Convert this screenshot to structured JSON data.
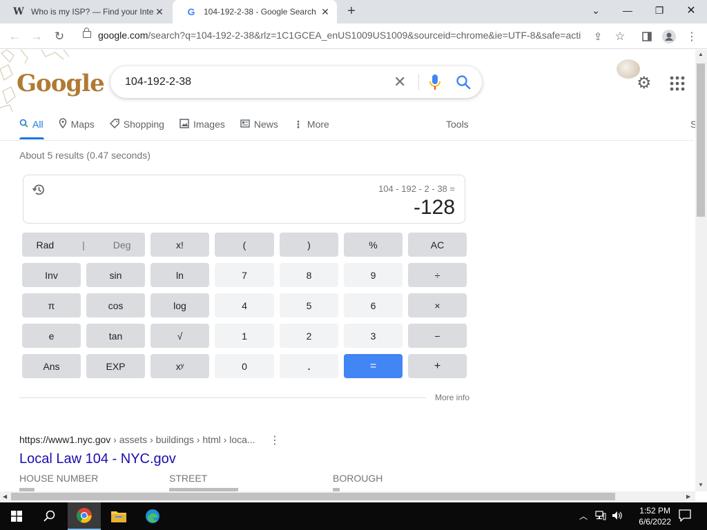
{
  "browser": {
    "tabs": [
      {
        "title": "Who is my ISP? — Find your Inte",
        "favicon": "W"
      },
      {
        "title": "104-192-2-38 - Google Search",
        "favicon": "G"
      }
    ],
    "url_domain": "google.com",
    "url_rest": "/search?q=104-192-2-38&rlz=1C1GCEA_enUS1009US1009&sourceid=chrome&ie=UTF-8&safe=acti..."
  },
  "search": {
    "logo": "Google",
    "query": "104-192-2-38",
    "tabs": [
      {
        "label": "All",
        "icon": "search-icon"
      },
      {
        "label": "Maps",
        "icon": "map-pin-icon"
      },
      {
        "label": "Shopping",
        "icon": "tag-icon"
      },
      {
        "label": "Images",
        "icon": "image-icon"
      },
      {
        "label": "News",
        "icon": "news-icon"
      },
      {
        "label": "More",
        "icon": "kebab-icon"
      }
    ],
    "tools_label": "Tools",
    "truncated_right": "S",
    "stats": "About 5 results (0.47 seconds)"
  },
  "calculator": {
    "expression": "104 - 192 - 2 - 38 =",
    "result": "-128",
    "rad": "Rad",
    "deg": "Deg",
    "keys": {
      "fact": "x!",
      "lparen": "(",
      "rparen": ")",
      "percent": "%",
      "ac": "AC",
      "inv": "Inv",
      "sin": "sin",
      "ln": "ln",
      "k7": "7",
      "k8": "8",
      "k9": "9",
      "div": "÷",
      "pi": "π",
      "cos": "cos",
      "log": "log",
      "k4": "4",
      "k5": "5",
      "k6": "6",
      "mul": "×",
      "e": "e",
      "tan": "tan",
      "sqrt": "√",
      "k1": "1",
      "k2": "2",
      "k3": "3",
      "minus": "−",
      "ans": "Ans",
      "exp": "EXP",
      "pow": "xʸ",
      "k0": "0",
      "dot": ".",
      "eq": "=",
      "plus": "+"
    },
    "more_info": "More info"
  },
  "result1": {
    "site": "https://www1.nyc.gov",
    "path": " › assets › buildings › html › loca...",
    "title": "Local Law 104 - NYC.gov",
    "columns": [
      "HOUSE NUMBER",
      "STREET",
      "BOROUGH"
    ]
  },
  "taskbar": {
    "time": "1:52 PM",
    "date": "6/6/2022"
  },
  "colors": {
    "accent": "#1a73e8",
    "link": "#1a0dab",
    "equals": "#4285f4"
  }
}
